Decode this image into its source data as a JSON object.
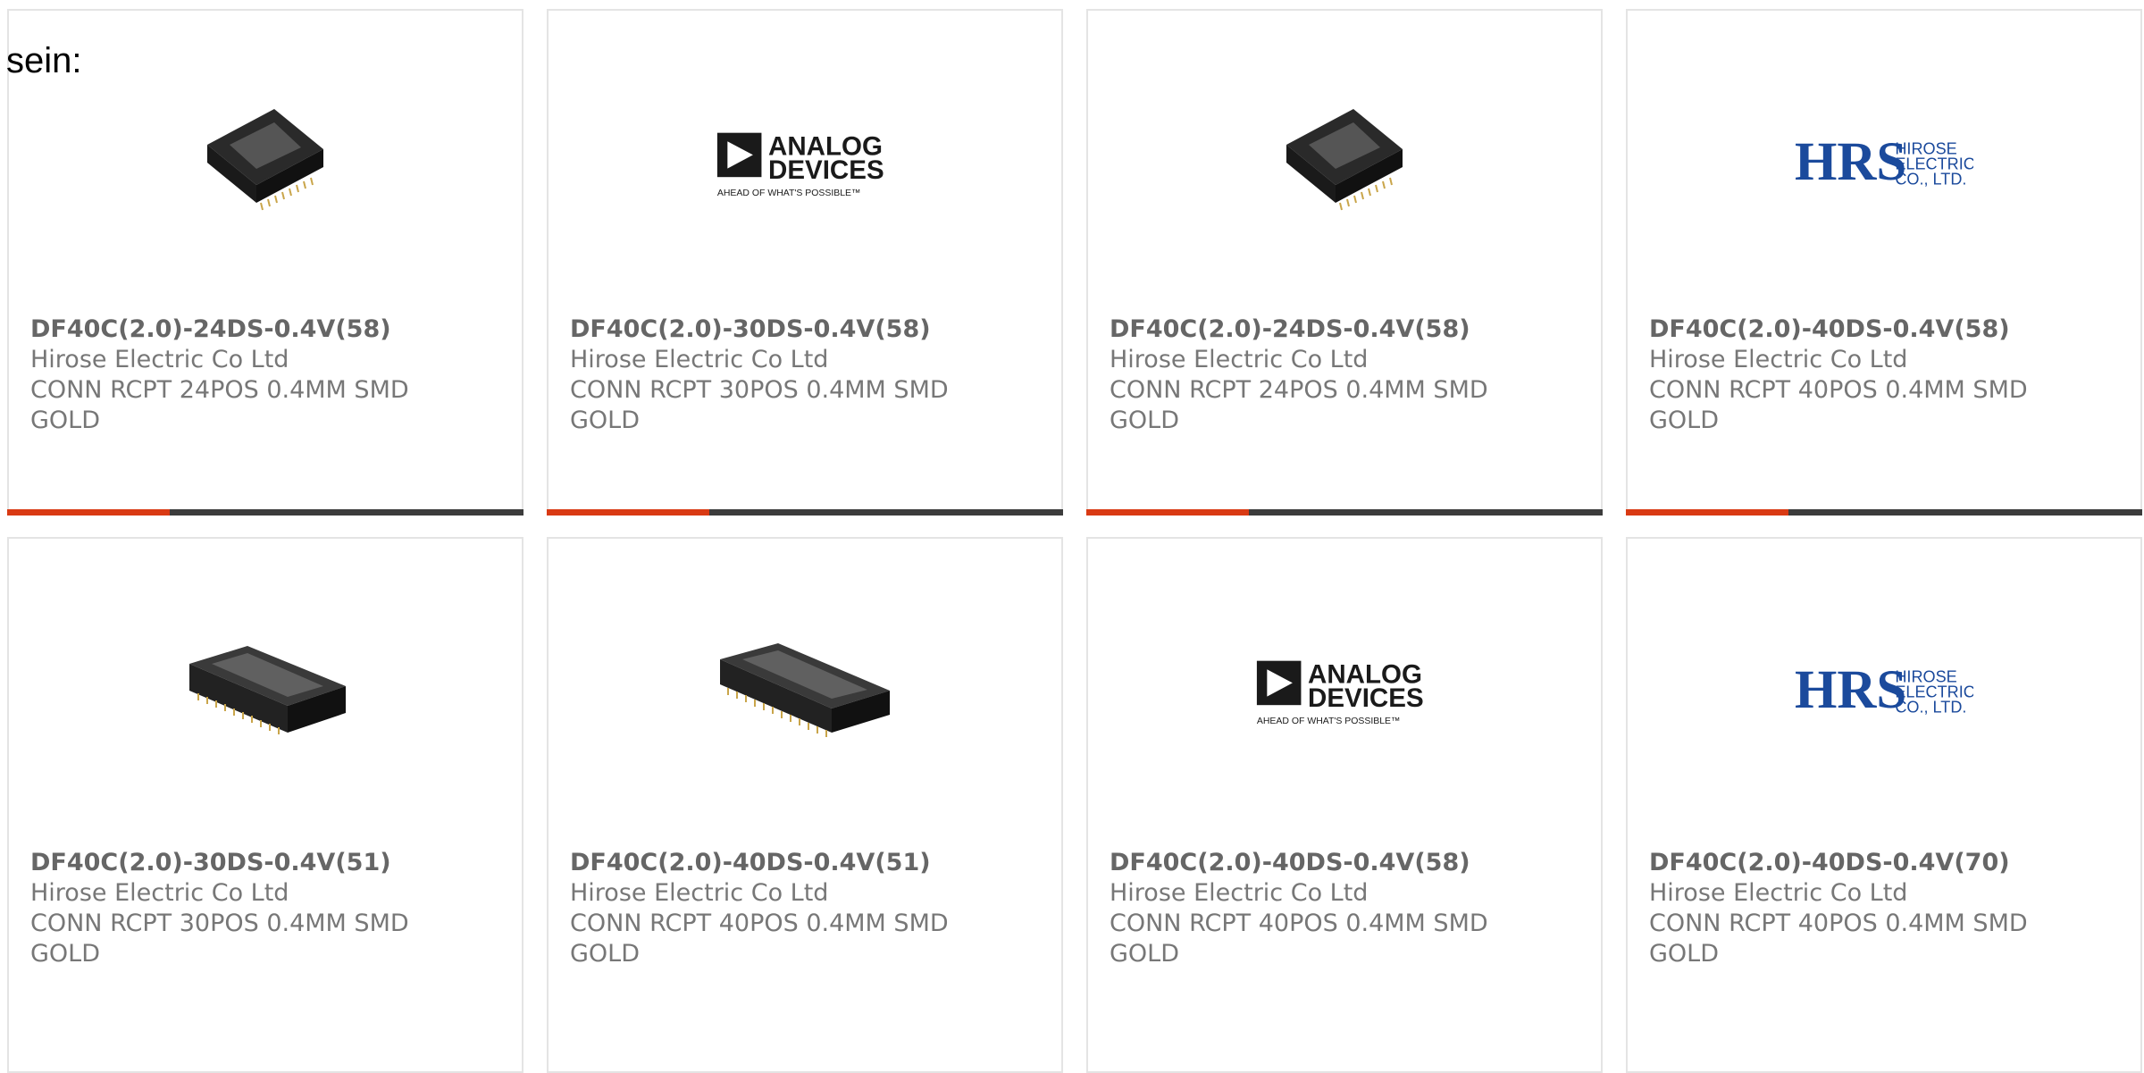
{
  "intro": "sein:",
  "colors": {
    "accent": "#d93a13",
    "bar": "#3c3c3c"
  },
  "products": [
    {
      "image": "connector-24-image",
      "part": "DF40C(2.0)-24DS-0.4V(58)",
      "mfr": "Hirose Electric Co Ltd",
      "desc1": "CONN RCPT 24POS 0.4MM SMD",
      "desc2": "GOLD"
    },
    {
      "image": "analog-devices-logo",
      "part": "DF40C(2.0)-30DS-0.4V(58)",
      "mfr": "Hirose Electric Co Ltd",
      "desc1": "CONN RCPT 30POS 0.4MM SMD",
      "desc2": "GOLD"
    },
    {
      "image": "connector-24-image",
      "part": "DF40C(2.0)-24DS-0.4V(58)",
      "mfr": "Hirose Electric Co Ltd",
      "desc1": "CONN RCPT 24POS 0.4MM SMD",
      "desc2": "GOLD"
    },
    {
      "image": "hirose-logo",
      "part": "DF40C(2.0)-40DS-0.4V(58)",
      "mfr": "Hirose Electric Co Ltd",
      "desc1": "CONN RCPT 40POS 0.4MM SMD",
      "desc2": "GOLD"
    },
    {
      "image": "connector-30-image",
      "part": "DF40C(2.0)-30DS-0.4V(51)",
      "mfr": "Hirose Electric Co Ltd",
      "desc1": "CONN RCPT 30POS 0.4MM SMD",
      "desc2": "GOLD"
    },
    {
      "image": "connector-40-image",
      "part": "DF40C(2.0)-40DS-0.4V(51)",
      "mfr": "Hirose Electric Co Ltd",
      "desc1": "CONN RCPT 40POS 0.4MM SMD",
      "desc2": "GOLD"
    },
    {
      "image": "analog-devices-logo",
      "part": "DF40C(2.0)-40DS-0.4V(58)",
      "mfr": "Hirose Electric Co Ltd",
      "desc1": "CONN RCPT 40POS 0.4MM SMD",
      "desc2": "GOLD"
    },
    {
      "image": "hirose-logo",
      "part": "DF40C(2.0)-40DS-0.4V(70)",
      "mfr": "Hirose Electric Co Ltd",
      "desc1": "CONN RCPT 40POS 0.4MM SMD",
      "desc2": "GOLD"
    }
  ],
  "logos": {
    "analog_devices": {
      "line1": "ANALOG",
      "line2": "DEVICES",
      "tagline": "AHEAD OF WHAT'S POSSIBLE™"
    },
    "hirose": {
      "mark": "HRS",
      "line1": "HIROSE",
      "line2": "ELECTRIC",
      "line3": "CO., LTD."
    }
  }
}
